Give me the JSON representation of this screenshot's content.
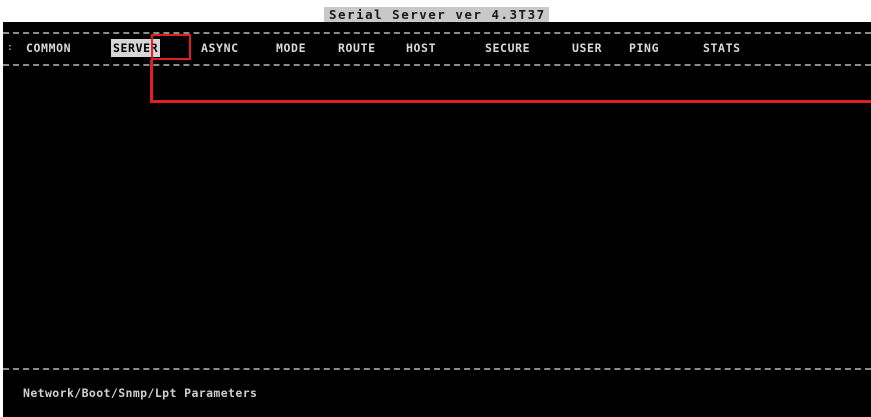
{
  "window": {
    "title": "Serial Server ver 4.3T37"
  },
  "menu": {
    "lead": ":",
    "items": [
      {
        "label": "COMMON"
      },
      {
        "label": "SERVER",
        "active": true
      },
      {
        "label": "ASYNC"
      },
      {
        "label": "MODE"
      },
      {
        "label": "ROUTE"
      },
      {
        "label": "HOST"
      },
      {
        "label": "SECURE"
      },
      {
        "label": "USER"
      },
      {
        "label": "PING"
      },
      {
        "label": "STATS"
      }
    ]
  },
  "status": {
    "text": "Network/Boot/Snmp/Lpt Parameters"
  },
  "colors": {
    "background": "#000000",
    "text": "#d8d8d8",
    "active_menu_bg": "#d6d6d6",
    "annotation": "#e02020"
  }
}
